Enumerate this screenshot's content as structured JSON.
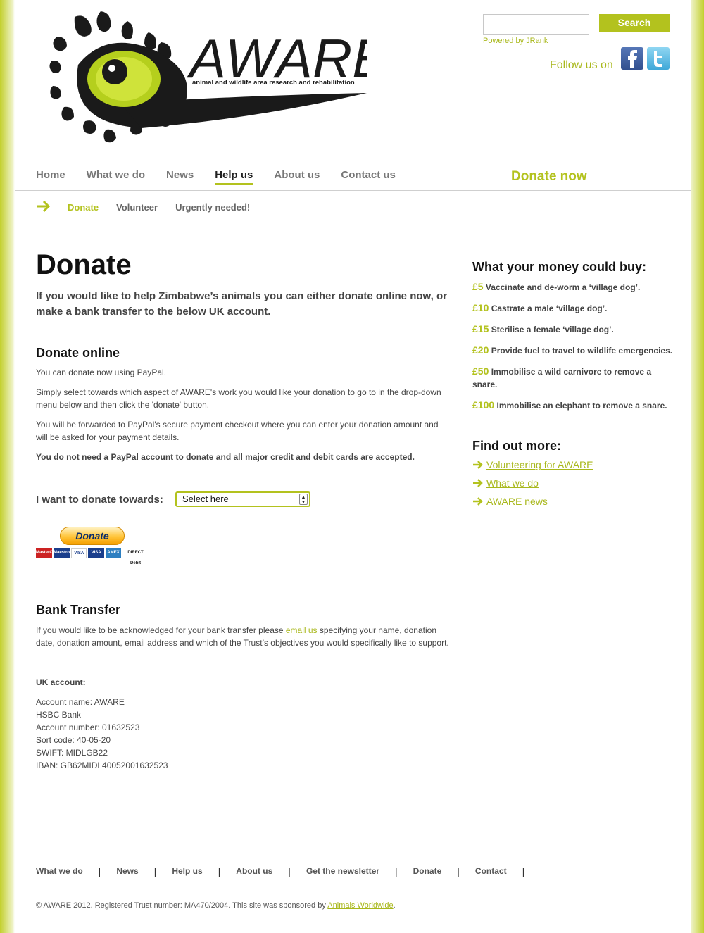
{
  "header": {
    "logo_text": "AWARE",
    "logo_tagline": "animal and wildlife area research and rehabilitation",
    "search_placeholder": "",
    "search_button": "Search",
    "powered_by": "Powered by JRank",
    "follow_us": "Follow us on"
  },
  "nav": {
    "items": [
      "Home",
      "What we do",
      "News",
      "Help us",
      "About us",
      "Contact us"
    ],
    "active": "Help us",
    "donate_now": "Donate now"
  },
  "subnav": {
    "items": [
      "Donate",
      "Volunteer",
      "Urgently needed!"
    ],
    "active": "Donate"
  },
  "main": {
    "title": "Donate",
    "intro": "If you would like to help Zimbabwe’s animals you can either donate online now, or make a bank transfer to the below UK account.",
    "online": {
      "heading": "Donate online",
      "p1": "You can donate now using PayPal.",
      "p2": "Simply select towards which aspect of AWARE's work you would like your donation to go to in the drop-down menu below and then click the 'donate' button.",
      "p3": "You will be forwarded to PayPal's secure payment checkout where you can enter your donation amount and will be asked for your payment details.",
      "p4": "You do not need a PayPal account to donate and all major credit and debit cards are accepted.",
      "donate_towards_label": "I want to donate towards:",
      "select_value": "Select here",
      "paypal_button": "Donate",
      "card_labels": [
        "MasterCard",
        "Maestro",
        "VISA",
        "VISA",
        "AMEX",
        "DIRECT Debit"
      ]
    },
    "bank": {
      "heading": "Bank Transfer",
      "text_before": "If you would like to be acknowledged for your bank transfer please ",
      "email_link": "email us",
      "text_after": " specifying your name, donation date, donation amount, email address and which of the Trust’s objectives you would specifically like to support.",
      "uk_heading": "UK account:",
      "lines": [
        "Account name: AWARE",
        "HSBC Bank",
        "Account number: 01632523",
        "Sort code: 40-05-20",
        "SWIFT: MIDLGB22",
        "IBAN: GB62MIDL40052001632523"
      ]
    }
  },
  "sidebar": {
    "buy_heading": "What your money could buy:",
    "buy_items": [
      {
        "amount": "£5",
        "text": "Vaccinate and de-worm a ‘village dog’."
      },
      {
        "amount": "£10",
        "text": "Castrate a male ‘village dog’."
      },
      {
        "amount": "£15",
        "text": "Sterilise a female ‘village dog’."
      },
      {
        "amount": "£20",
        "text": "Provide fuel to travel to wildlife emergencies."
      },
      {
        "amount": "£50",
        "text": "Immobilise a wild carnivore to remove a snare."
      },
      {
        "amount": "£100",
        "text": "Immobilise an elephant to remove a snare."
      }
    ],
    "find_heading": "Find out more:",
    "find_items": [
      "Volunteering for AWARE",
      "What we do",
      "AWARE news"
    ]
  },
  "footer": {
    "links": [
      "What we do",
      "News",
      "Help us",
      "About us",
      "Get the newsletter",
      "Donate",
      "Contact"
    ],
    "separator": "|",
    "copyright_before": "© AWARE 2012. Registered Trust number: MA470/2004. This site was sponsored by ",
    "sponsor": "Animals Worldwide",
    "copyright_after": "."
  },
  "colors": {
    "accent": "#b3c21e",
    "link": "#a9b81c",
    "text": "#444444"
  }
}
